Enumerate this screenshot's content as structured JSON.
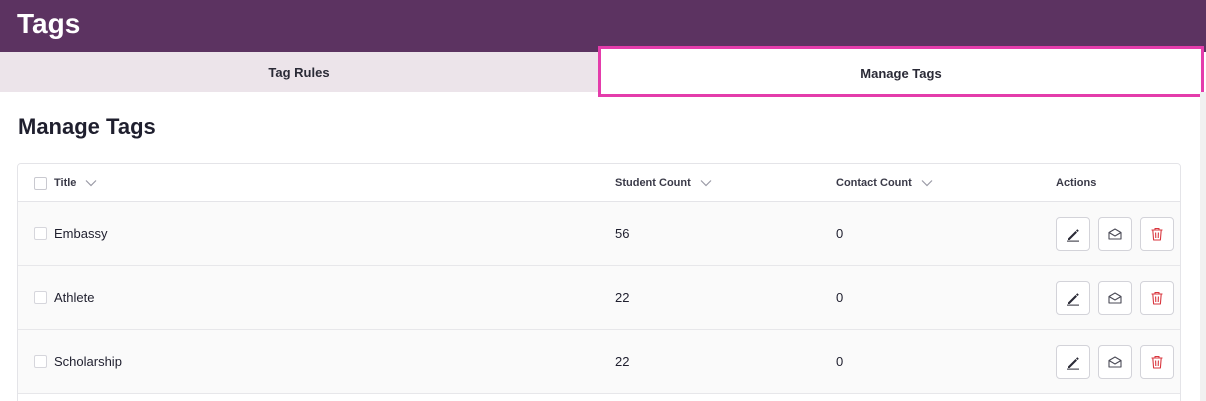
{
  "header": {
    "title": "Tags",
    "bg_color": "#5c3361"
  },
  "tabs": [
    {
      "label": "Tag Rules",
      "active": false
    },
    {
      "label": "Manage Tags",
      "active": true
    }
  ],
  "section": {
    "title": "Manage Tags"
  },
  "table": {
    "columns": [
      {
        "label": "Title",
        "sortable": true
      },
      {
        "label": "Student Count",
        "sortable": true
      },
      {
        "label": "Contact Count",
        "sortable": true
      },
      {
        "label": "Actions",
        "sortable": false
      }
    ],
    "rows": [
      {
        "title": "Embassy",
        "student_count": "56",
        "contact_count": "0"
      },
      {
        "title": "Athlete",
        "student_count": "22",
        "contact_count": "0"
      },
      {
        "title": "Scholarship",
        "student_count": "22",
        "contact_count": "0"
      }
    ],
    "action_icons": [
      "pencil-icon",
      "envelope-icon",
      "trash-icon"
    ]
  },
  "colors": {
    "accent_highlight": "#e43cab",
    "tab_inactive_bg": "#ece4ea",
    "delete_red": "#d9363e"
  }
}
